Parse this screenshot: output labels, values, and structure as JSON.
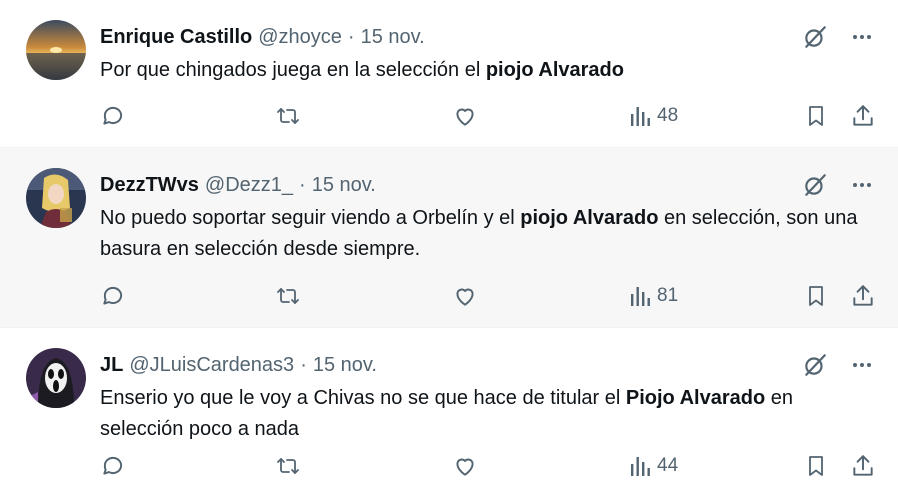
{
  "tweets": [
    {
      "name": "Enrique Castillo",
      "handle": "@zhoyce",
      "separator": "·",
      "date": "15 nov.",
      "text_parts": [
        "Por que chingados juega en la selección el ",
        "piojo Alvarado",
        ""
      ],
      "views": "48",
      "avatar": "sunset-avatar"
    },
    {
      "name": "DezzTWvs",
      "handle": "@Dezz1_",
      "separator": "·",
      "date": "15 nov.",
      "text_parts": [
        "No puedo soportar seguir viendo a Orbelín y el ",
        "piojo Alvarado",
        " en selección, son una basura en selección desde siempre."
      ],
      "views": "81",
      "avatar": "anime-avatar"
    },
    {
      "name": "JL",
      "handle": "@JLuisCardenas3",
      "separator": "·",
      "date": "15 nov.",
      "text_parts": [
        "Enserio yo que le voy a Chivas no se que hace de titular el ",
        "Piojo Alvarado",
        " en selección poco a nada"
      ],
      "views": "44",
      "avatar": "ghostface-avatar"
    }
  ],
  "icons": {
    "reply": "reply-icon",
    "retweet": "retweet-icon",
    "like": "like-icon",
    "views": "views-icon",
    "bookmark": "bookmark-icon",
    "share": "share-icon",
    "grok": "grok-icon",
    "more": "more-icon"
  },
  "colors": {
    "text": "#0f1419",
    "secondary": "#536471",
    "highlight_bg": "#f7f7f7"
  }
}
